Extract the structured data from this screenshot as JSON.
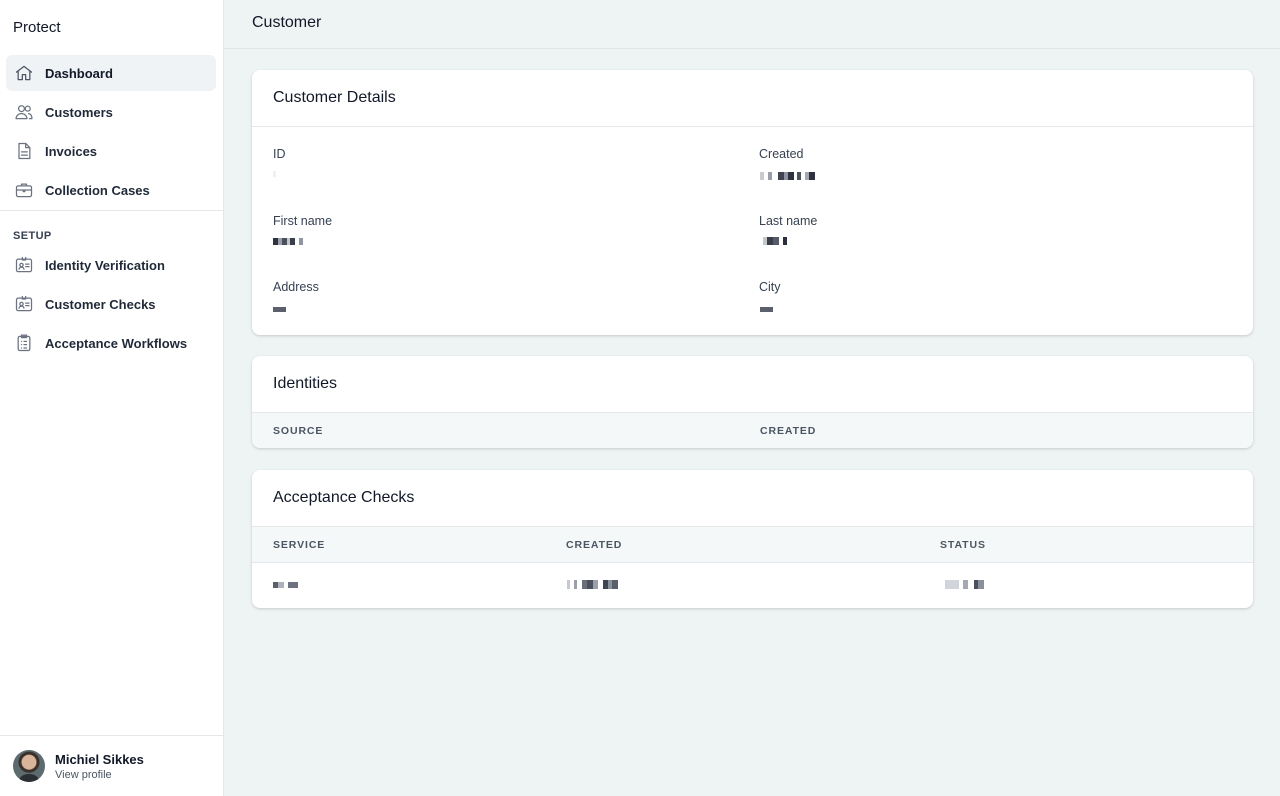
{
  "sidebar": {
    "brand": "Protect",
    "nav": [
      {
        "label": "Dashboard",
        "icon": "home-icon",
        "active": true
      },
      {
        "label": "Customers",
        "icon": "users-icon"
      },
      {
        "label": "Invoices",
        "icon": "document-icon"
      },
      {
        "label": "Collection Cases",
        "icon": "briefcase-icon"
      }
    ],
    "setup_title": "SETUP",
    "setup": [
      {
        "label": "Identity Verification",
        "icon": "id-card-icon"
      },
      {
        "label": "Customer Checks",
        "icon": "id-card-icon"
      },
      {
        "label": "Acceptance Workflows",
        "icon": "clipboard-list-icon"
      }
    ],
    "profile": {
      "name": "Michiel Sikkes",
      "link": "View profile"
    }
  },
  "header": {
    "title": "Customer"
  },
  "customer_details": {
    "title": "Customer Details",
    "fields": {
      "id": "ID",
      "created": "Created",
      "first_name": "First name",
      "last_name": "Last name",
      "address": "Address",
      "city": "City"
    }
  },
  "identities": {
    "title": "Identities",
    "columns": [
      "SOURCE",
      "CREATED"
    ]
  },
  "acceptance_checks": {
    "title": "Acceptance Checks",
    "columns": [
      "SERVICE",
      "CREATED",
      "STATUS"
    ]
  },
  "colors": {
    "background": "#eef3f4",
    "sidebar": "#ffffff",
    "active_nav": "#f0f3f5",
    "table_header": "#f5f8f8"
  }
}
